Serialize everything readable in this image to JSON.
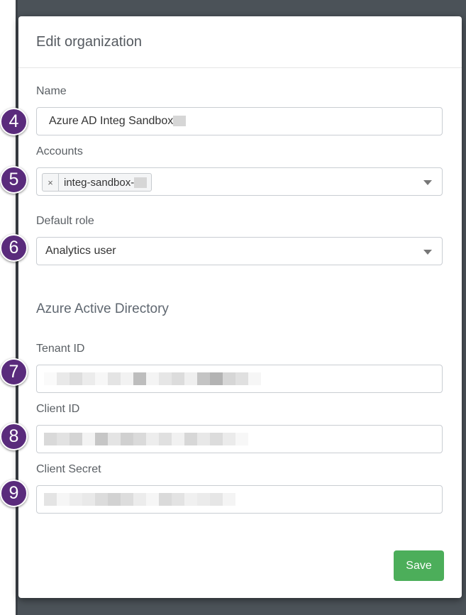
{
  "modal": {
    "title": "Edit organization"
  },
  "name_field": {
    "label": "Name",
    "value": "Azure AD Integ Sandbox"
  },
  "accounts_field": {
    "label": "Accounts",
    "tag_remove": "×",
    "tag_label": "integ-sandbox-"
  },
  "default_role_field": {
    "label": "Default role",
    "value": "Analytics user"
  },
  "azure_section": {
    "title": "Azure Active Directory"
  },
  "tenant_id_field": {
    "label": "Tenant ID"
  },
  "client_id_field": {
    "label": "Client ID"
  },
  "client_secret_field": {
    "label": "Client Secret"
  },
  "markers": [
    "4",
    "5",
    "6",
    "7",
    "8",
    "9"
  ],
  "actions": {
    "save_label": "Save"
  },
  "colors": {
    "accent_green": "#4cae5a",
    "marker_purple": "#5a2b7c",
    "backdrop": "#4b5258"
  }
}
